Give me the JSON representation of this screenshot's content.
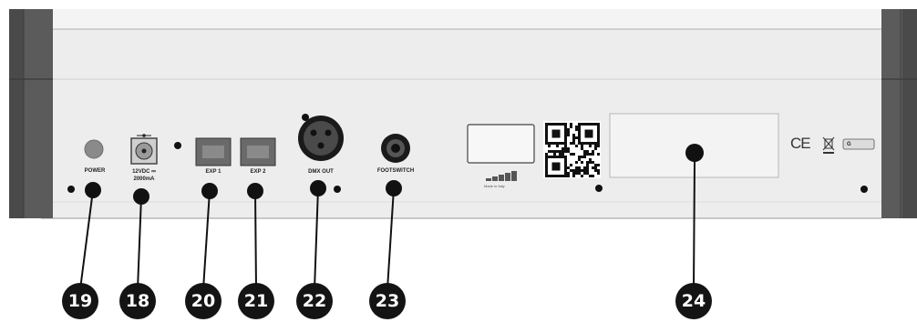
{
  "labels": {
    "power": "POWER",
    "dc_volt": "12VDC ⎓",
    "dc_amp": "2000mA",
    "exp1": "EXP 1",
    "exp2": "EXP 2",
    "dmx": "DMX OUT",
    "footswitch": "FOOTSWITCH"
  },
  "callouts": [
    "19",
    "18",
    "20",
    "21",
    "22",
    "23",
    "24"
  ],
  "markings": {
    "ce": "CE",
    "small_badge": "G",
    "qr_caption": "",
    "logo_caption": "Made in Italy"
  },
  "colors": {
    "panel": "#eeeeee",
    "end_cap": "#555555",
    "callout": "#141414"
  }
}
